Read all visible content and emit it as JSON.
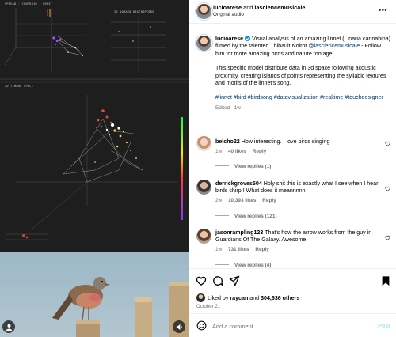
{
  "media": {
    "viz_labels": {
      "panel_top_left": "SPREAD · CENTROID · CREST",
      "panel_top_right": "3D DOMAIN DESCRIPTORS",
      "panel_mid": "3D TIMBRE SPACE"
    },
    "sound_button_icon": "speaker-icon",
    "user_button_icon": "user-icon"
  },
  "header": {
    "user1": "lucioarese",
    "joiner": " and ",
    "user2": "lasciencemusicale",
    "audio": "Original audio",
    "more_icon": "more-icon"
  },
  "caption": {
    "username": "lucioarese",
    "text1": " Visual analysis of an amazing linnet (Linaria cannabina) filmed by the talented Thibault Noirot ",
    "mention": "@lasciencemusicale",
    "text2": " - Follow him for more amazing birds and nature footage!",
    "para2": "This specific model distribute data in 3d space following acoustic proximity, creating islands of points representing the syllabic textures and motifs of the linnet's song.",
    "hashtags": "#linnet #bird #birdsong #datavisualization #realtime #touchdesigner",
    "meta": "Edited · 1w"
  },
  "comments": [
    {
      "username": "belcho22",
      "text": " How interesting. I love birds singing",
      "time": "1w",
      "likes": "40 likes",
      "reply": "Reply",
      "view_replies": "View replies (1)"
    },
    {
      "username": "derrickgroves504",
      "text": " Holy shit this is exactly what I see when I hear birds chirp!! What does it meannnnn",
      "time": "2w",
      "likes": "10,393 likes",
      "reply": "Reply",
      "view_replies": "View replies (121)"
    },
    {
      "username": "jasonrampling123",
      "text": " That's how the arrow works from the guy in Guardians Of The Galaxy. Awesome",
      "time": "1w",
      "likes": "731 likes",
      "reply": "Reply",
      "view_replies": "View replies (4)"
    }
  ],
  "actions": {
    "liked_prefix": "Liked by ",
    "liked_user": "raycan",
    "liked_joiner": " and ",
    "liked_count": "304,636 others",
    "date": "October 21"
  },
  "add_comment": {
    "placeholder": "Add a comment...",
    "post_label": "Post"
  },
  "colors": {
    "link": "#00376b",
    "verified": "#0095f6",
    "post_disabled": "#b2dffc"
  }
}
